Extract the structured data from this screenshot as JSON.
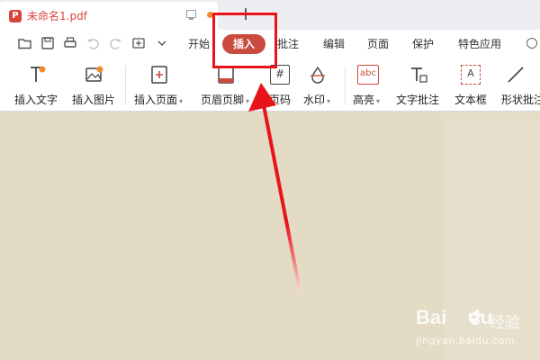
{
  "tab": {
    "title": "未命名1.pdf",
    "pdf_glyph": "P",
    "new_tab": "+"
  },
  "quick_access": [
    "folder-open-icon",
    "save-icon",
    "print-icon",
    "undo-icon",
    "redo-icon",
    "export-icon",
    "dropdown-icon"
  ],
  "menu": {
    "tabs": [
      "开始",
      "插入",
      "批注",
      "编辑",
      "页面",
      "保护",
      "特色应用"
    ],
    "active": "插入"
  },
  "ribbon": {
    "items": [
      {
        "label": "插入文字",
        "icon": "insert-text-icon"
      },
      {
        "label": "插入图片",
        "icon": "insert-image-icon"
      },
      {
        "label": "插入页面",
        "icon": "insert-page-icon",
        "dropdown": true
      },
      {
        "label": "页眉页脚",
        "icon": "header-footer-icon",
        "dropdown": true
      },
      {
        "label": "页码",
        "icon": "page-number-icon"
      },
      {
        "label": "水印",
        "icon": "watermark-icon",
        "dropdown": true
      },
      {
        "label": "高亮",
        "icon": "highlight-icon",
        "dropdown": true
      },
      {
        "label": "文字批注",
        "icon": "text-annotation-icon"
      },
      {
        "label": "文本框",
        "icon": "textbox-icon"
      },
      {
        "label": "形状批注",
        "icon": "shape-annotation-icon"
      }
    ],
    "icon_glyphs": {
      "abc": "abc",
      "hash": "#",
      "textbox": "A"
    },
    "caret": "▾"
  },
  "watermark": {
    "brand": "Bai",
    "brand_tail": "du",
    "cn": "经验",
    "url": "jingyan.baidu.com"
  },
  "colors": {
    "accent": "#c94a3e",
    "annotation": "#e8141a",
    "canvas": "#e3dbc4"
  }
}
